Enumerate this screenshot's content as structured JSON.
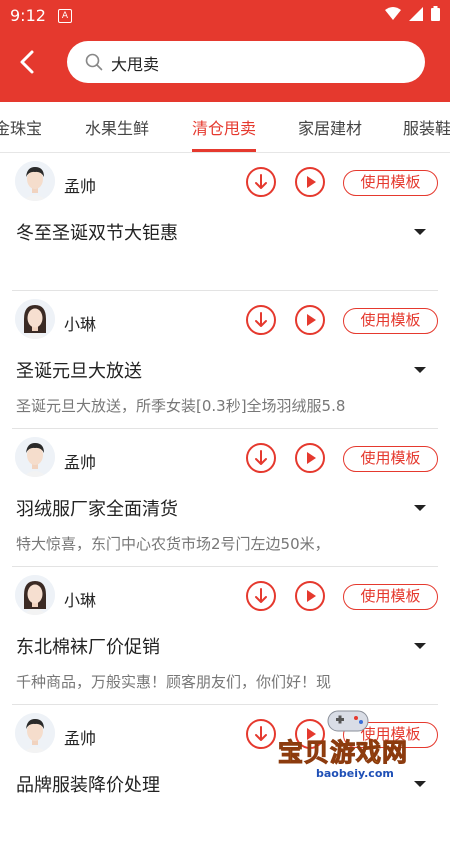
{
  "status_bar": {
    "time": "9:12",
    "notification_glyph": "A",
    "colors": {
      "bar": "#e5392e"
    }
  },
  "search": {
    "query": "大甩卖"
  },
  "tabs": [
    {
      "label": "金珠宝"
    },
    {
      "label": "水果生鲜"
    },
    {
      "label": "清仓甩卖",
      "active": true
    },
    {
      "label": "家居建材"
    },
    {
      "label": "服装鞋"
    }
  ],
  "cards": [
    {
      "user": "孟帅",
      "avatar": "male-avatar",
      "title": "冬至圣诞双节大钜惠",
      "desc": "",
      "template_label": "使用模板"
    },
    {
      "user": "小琳",
      "avatar": "female-avatar",
      "title": "圣诞元旦大放送",
      "desc": "圣诞元旦大放送，所季女装[0.3秒]全场羽绒服5.8",
      "template_label": "使用模板"
    },
    {
      "user": "孟帅",
      "avatar": "male-avatar",
      "title": "羽绒服厂家全面清货",
      "desc": "特大惊喜，东门中心农货市场2号门左边50米，",
      "template_label": "使用模板"
    },
    {
      "user": "小琳",
      "avatar": "female-avatar",
      "title": "东北棉袜厂价促销",
      "desc": "千种商品，万般实惠！顾客朋友们，你们好！现",
      "template_label": "使用模板"
    },
    {
      "user": "孟帅",
      "avatar": "male-avatar",
      "title": "品牌服装降价处理",
      "desc": "",
      "template_label": "使用模板"
    }
  ],
  "watermark": {
    "brand": "宝贝游戏网",
    "url": "baobeiy.com"
  }
}
